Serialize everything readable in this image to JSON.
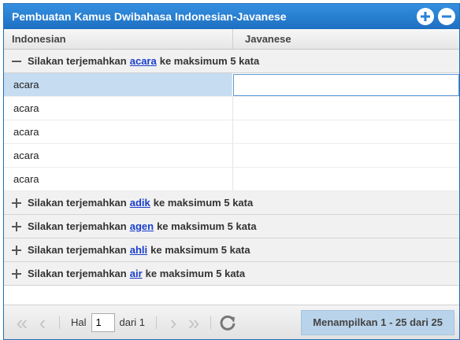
{
  "window": {
    "title": "Pembuatan Kamus Dwibahasa Indonesian-Javanese",
    "add_icon": "plus-circle-icon",
    "remove_icon": "minus-circle-icon"
  },
  "columns": {
    "col1": "Indonesian",
    "col2": "Javanese"
  },
  "groups": [
    {
      "prefix": "Silakan terjemahkan",
      "word": "acara",
      "suffix": "ke maksimum 5 kata",
      "expanded": true,
      "rows": [
        "acara",
        "acara",
        "acara",
        "acara",
        "acara"
      ]
    },
    {
      "prefix": "Silakan terjemahkan",
      "word": "adik",
      "suffix": "ke maksimum 5 kata",
      "expanded": false
    },
    {
      "prefix": "Silakan terjemahkan",
      "word": "agen",
      "suffix": "ke maksimum 5 kata",
      "expanded": false
    },
    {
      "prefix": "Silakan terjemahkan",
      "word": "ahli",
      "suffix": "ke maksimum 5 kata",
      "expanded": false
    },
    {
      "prefix": "Silakan terjemahkan",
      "word": "air",
      "suffix": "ke maksimum 5 kata",
      "expanded": false
    }
  ],
  "pager": {
    "page_label": "Hal",
    "page_value": "1",
    "of_label": "dari 1",
    "status": "Menampilkan 1 - 25 dari 25",
    "first_icon": "double-chevron-left-icon",
    "prev_icon": "chevron-left-icon",
    "next_icon": "chevron-right-icon",
    "last_icon": "double-chevron-right-icon",
    "refresh_icon": "refresh-icon"
  },
  "colors": {
    "titlebar": "#2a82d6",
    "selected_row": "#c5dcf1",
    "link": "#1a3ecc"
  }
}
